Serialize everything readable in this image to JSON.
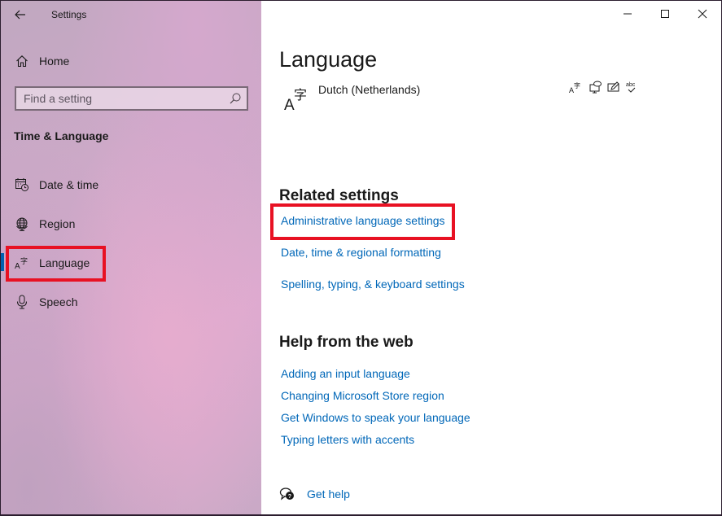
{
  "window": {
    "title": "Settings",
    "controls": {
      "minimize": "minimize-icon",
      "maximize": "maximize-icon",
      "close": "close-icon"
    }
  },
  "sidebar": {
    "home_label": "Home",
    "search": {
      "placeholder": "Find a setting",
      "value": ""
    },
    "section_title": "Time & Language",
    "items": [
      {
        "label": "Date & time",
        "icon": "calendar-clock-icon",
        "active": false
      },
      {
        "label": "Region",
        "icon": "globe-icon",
        "active": false
      },
      {
        "label": "Language",
        "icon": "language-icon",
        "active": true,
        "highlighted": true
      },
      {
        "label": "Speech",
        "icon": "microphone-icon",
        "active": false
      }
    ]
  },
  "main": {
    "page_title": "Language",
    "installed_language": {
      "name": "Dutch (Netherlands)",
      "features": [
        "display-language-icon",
        "speech-icon",
        "handwriting-icon",
        "spell-check-icon"
      ]
    },
    "related_settings": {
      "title": "Related settings",
      "links": [
        {
          "label": "Administrative language settings",
          "highlighted": true
        },
        {
          "label": "Date, time & regional formatting",
          "highlighted": false
        },
        {
          "label": "Spelling, typing, & keyboard settings",
          "highlighted": false
        }
      ]
    },
    "help_from_web": {
      "title": "Help from the web",
      "links": [
        {
          "label": "Adding an input language"
        },
        {
          "label": "Changing Microsoft Store region"
        },
        {
          "label": "Get Windows to speak your language"
        },
        {
          "label": "Typing letters with accents"
        }
      ]
    },
    "get_help_label": "Get help"
  },
  "colors": {
    "accent": "#0067b8",
    "active_indicator": "#0063b1",
    "highlight": "#e81123"
  }
}
